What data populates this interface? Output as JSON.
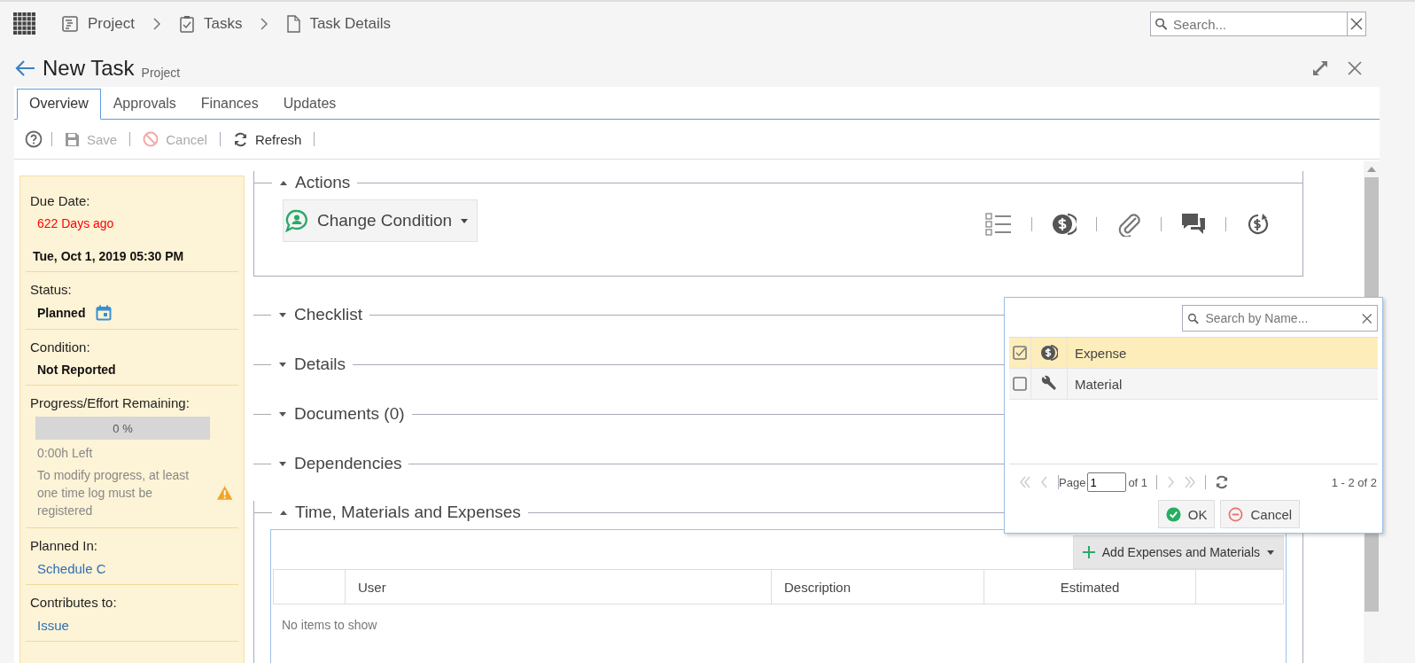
{
  "breadcrumbs": [
    {
      "label": "Project",
      "kind": "project"
    },
    {
      "label": "Tasks",
      "kind": "tasks"
    },
    {
      "label": "Task Details",
      "kind": "document"
    }
  ],
  "search": {
    "placeholder": "Search..."
  },
  "header": {
    "title": "New Task",
    "subtitle": "Project"
  },
  "tabs": [
    {
      "label": "Overview",
      "selected": true
    },
    {
      "label": "Approvals",
      "selected": false
    },
    {
      "label": "Finances",
      "selected": false
    },
    {
      "label": "Updates",
      "selected": false
    }
  ],
  "toolbar": [
    {
      "label": "Save",
      "kind": "save",
      "disabled": true
    },
    {
      "label": "Cancel",
      "kind": "cancel",
      "disabled": true
    },
    {
      "label": "Refresh",
      "kind": "refresh",
      "disabled": false
    }
  ],
  "sidebar": [
    {
      "label": "Due Date:",
      "values": [
        {
          "text": "622 Days ago",
          "kind": "overdue"
        },
        {
          "text": "Tue, Oct 1, 2019 05:30 PM",
          "kind": "date"
        }
      ]
    },
    {
      "label": "Status:",
      "values": [
        {
          "text": "Planned",
          "kind": "status"
        }
      ]
    },
    {
      "label": "Condition:",
      "values": [
        {
          "text": "Not Reported",
          "kind": "bold"
        }
      ]
    },
    {
      "label": "Progress/Effort Remaining:",
      "progress": {
        "level": 0,
        "reading": "0 %"
      },
      "values": [
        {
          "text": "0:00h Left",
          "kind": "muted"
        },
        {
          "text": "To modify progress, at least one time log must be registered",
          "kind": "warning"
        }
      ]
    },
    {
      "label": "Planned In:",
      "values": [
        {
          "text": "Schedule C",
          "kind": "link"
        }
      ]
    },
    {
      "label": "Contributes to:",
      "values": [
        {
          "text": "Issue",
          "kind": "link"
        }
      ]
    }
  ],
  "sections": [
    {
      "title": "Actions",
      "expanded": true,
      "kind": "actions"
    },
    {
      "title": "Checklist",
      "expanded": false
    },
    {
      "title": "Details",
      "expanded": false
    },
    {
      "title": "Documents (0)",
      "expanded": false
    },
    {
      "title": "Dependencies",
      "expanded": false
    },
    {
      "title": "Time, Materials and Expenses",
      "expanded": true,
      "kind": "table"
    }
  ],
  "actions": {
    "button": "Change Condition",
    "icons": [
      {
        "kind": "checklist"
      },
      {
        "kind": "money"
      },
      {
        "kind": "attachment"
      },
      {
        "kind": "comments"
      },
      {
        "kind": "refund"
      }
    ]
  },
  "expenses_table": {
    "add_button": "Add Expenses and Materials",
    "columns": [
      "User",
      "Description",
      "Estimated"
    ],
    "empty": "No items to show"
  },
  "popup": {
    "search_placeholder": "Search by Name...",
    "items": [
      {
        "label": "Expense",
        "kind": "expense",
        "checked": true,
        "selected": true
      },
      {
        "label": "Material",
        "kind": "material",
        "checked": false,
        "selected": false
      }
    ],
    "page_label": "Page",
    "page_value": "1",
    "page_of": "of 1",
    "range": "1 - 2 of 2",
    "ok": "OK",
    "cancel": "Cancel"
  }
}
